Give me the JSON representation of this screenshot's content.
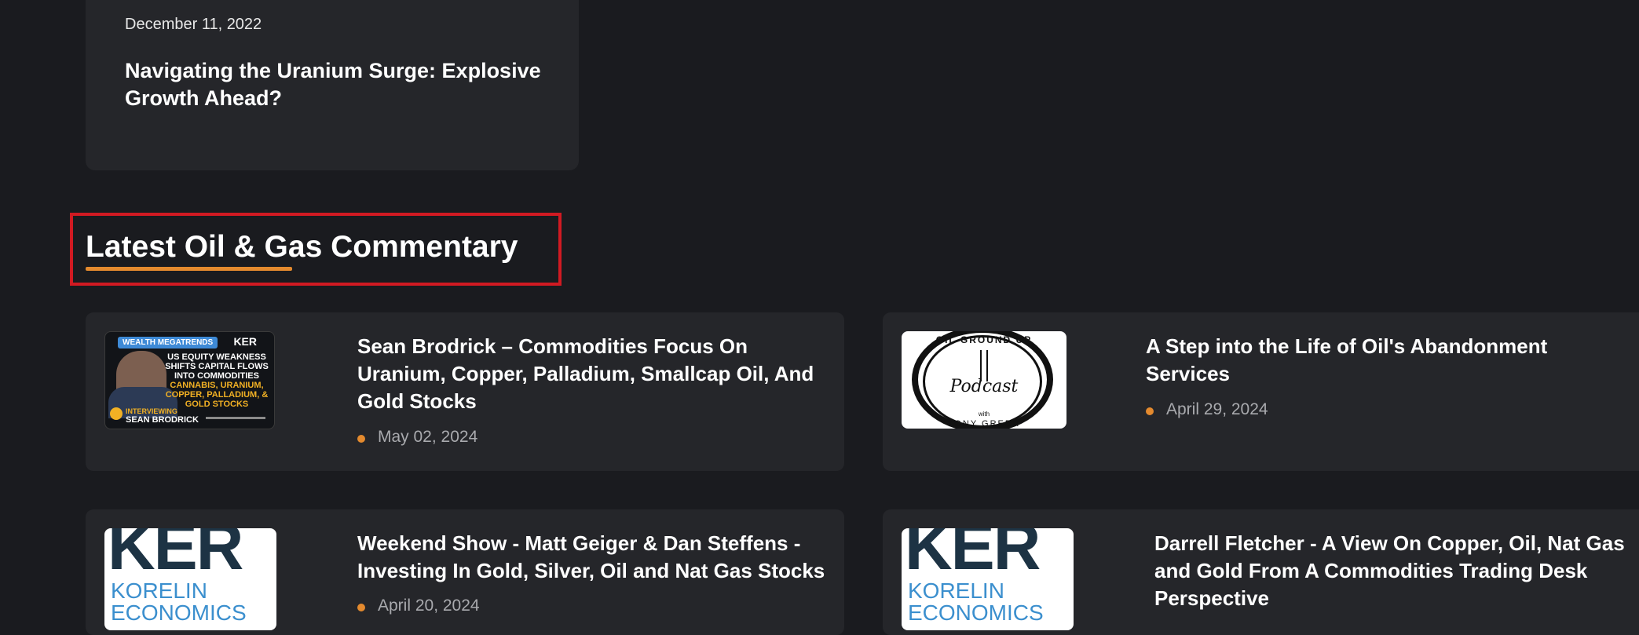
{
  "featured_card": {
    "date": "December 11, 2022",
    "title": "Navigating the Uranium Surge: Explosive Growth Ahead?"
  },
  "section": {
    "title": "Latest Oil & Gas Commentary",
    "accent_color": "#e48a2e",
    "highlight_color": "#d11a22"
  },
  "articles": [
    {
      "title": "Sean Brodrick – Commodities Focus On Uranium, Copper, Palladium, Smallcap Oil, And Gold Stocks",
      "date": "May 02, 2024",
      "thumbnail": {
        "tag": "WEALTH MEGATRENDS",
        "brand": "KER",
        "headline": "US EQUITY WEAKNESS SHIFTS CAPITAL FLOWS INTO COMMODITIES",
        "subhead": "CANNABIS, URANIUM, COPPER, PALLADIUM, & GOLD STOCKS",
        "interviewing": "INTERVIEWING",
        "guest": "SEAN BRODRICK"
      }
    },
    {
      "title": "A Step into the Life of Oil's Abandonment Services",
      "date": "April 29, 2024",
      "thumbnail": {
        "top": "OIL GROUND UP",
        "word": "Podcast",
        "with": "with",
        "bottom": "TONY GREER"
      }
    },
    {
      "title": "Weekend Show - Matt Geiger & Dan Steffens - Investing In Gold, Silver, Oil and Nat Gas Stocks",
      "date": "April 20, 2024",
      "thumbnail": {
        "mark": "KER",
        "line1": "KORELIN",
        "line2": "ECONOMICS"
      }
    },
    {
      "title": "Darrell Fletcher - A View On Copper, Oil, Nat Gas and Gold From A Commodities Trading Desk Perspective",
      "date": "",
      "thumbnail": {
        "mark": "KER",
        "line1": "KORELIN",
        "line2": "ECONOMICS"
      }
    }
  ]
}
